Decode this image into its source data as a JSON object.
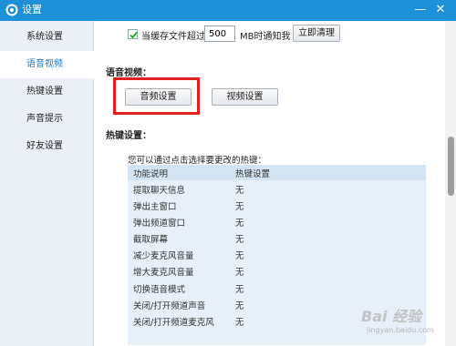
{
  "window": {
    "title": "设置",
    "logo_icon": "gear-logo-icon",
    "minimize_label": "—",
    "close_label": "✕",
    "accent_color": "#1e90d8"
  },
  "sidebar": {
    "items": [
      {
        "label": "系统设置",
        "active": false
      },
      {
        "label": "语音视频",
        "active": true
      },
      {
        "label": "热键设置",
        "active": false
      },
      {
        "label": "声音提示",
        "active": false
      },
      {
        "label": "好友设置",
        "active": false
      }
    ]
  },
  "cache": {
    "checked": true,
    "label": "当缓存文件超过",
    "value": "500",
    "unit_label": "MB时通知我",
    "clean_button": "立即清理"
  },
  "voice_video": {
    "title": "语音视频：",
    "audio_button": "音频设置",
    "video_button": "视频设置",
    "highlight_color": "#e02020"
  },
  "hotkeys": {
    "title": "热键设置：",
    "hint": "您可以通过点击选择要更改的热键：",
    "columns": [
      "功能说明",
      "热键设置"
    ],
    "rows": [
      [
        "提取聊天信息",
        "无"
      ],
      [
        "弹出主窗口",
        "无"
      ],
      [
        "弹出频道窗口",
        "无"
      ],
      [
        "截取屏幕",
        "无"
      ],
      [
        "减少麦克风音量",
        "无"
      ],
      [
        "增大麦克风音量",
        "无"
      ],
      [
        "切换语音模式",
        "无"
      ],
      [
        "关闭/打开频道声音",
        "无"
      ],
      [
        "关闭/打开频道麦克风",
        "无"
      ]
    ]
  },
  "watermark": {
    "text": "Bai 经验",
    "sub": "jingyan.baidu.com"
  }
}
